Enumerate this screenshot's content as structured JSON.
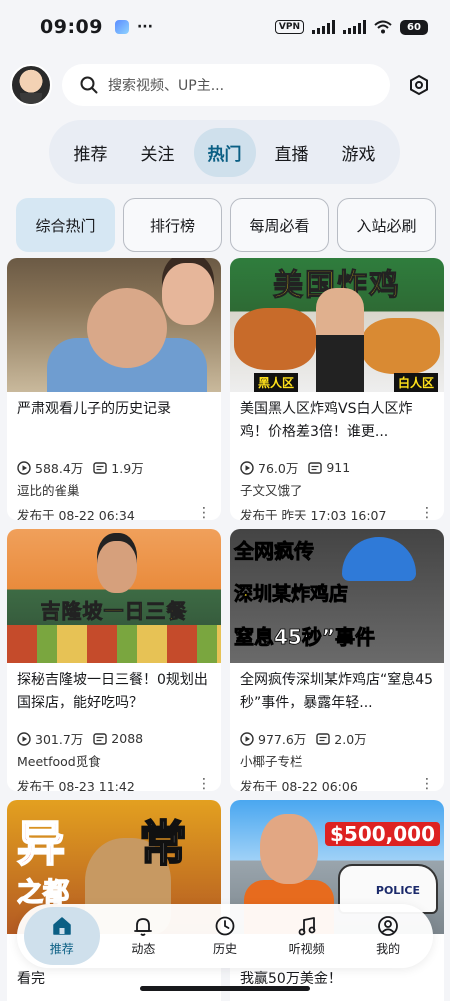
{
  "status_bar": {
    "time": "09:09",
    "dots": "···",
    "vpn": "VPN",
    "battery": "60"
  },
  "search": {
    "placeholder": "搜索视频、UP主..."
  },
  "main_tabs": [
    {
      "label": "推荐",
      "active": false
    },
    {
      "label": "关注",
      "active": false
    },
    {
      "label": "热门",
      "active": true
    },
    {
      "label": "直播",
      "active": false
    },
    {
      "label": "游戏",
      "active": false
    }
  ],
  "sub_tabs": [
    {
      "label": "综合热门",
      "active": true
    },
    {
      "label": "排行榜",
      "active": false
    },
    {
      "label": "每周必看",
      "active": false
    },
    {
      "label": "入站必刷",
      "active": false
    }
  ],
  "videos": [
    {
      "title": "严肃观看儿子的历史记录",
      "views": "588.4万",
      "danmaku": "1.9万",
      "uploader": "逗比的雀巢",
      "published": "发布于 08-22 06:34"
    },
    {
      "title": "美国黑人区炸鸡VS白人区炸鸡！价格差3倍！谁更...",
      "views": "76.0万",
      "danmaku": "911",
      "uploader": "子文又饿了",
      "published": "发布于 昨天 17:03 16:07",
      "thumb_text": {
        "headline": "美国炸鸡",
        "left_label": "黑人区",
        "right_label": "白人区"
      }
    },
    {
      "title": "探秘吉隆坡一日三餐！0规划出国探店，能好吃吗？",
      "views": "301.7万",
      "danmaku": "2088",
      "uploader": "Meetfood觅食",
      "published": "发布于 08-23 11:42",
      "thumb_text": {
        "headline": "吉隆坡一日三餐"
      }
    },
    {
      "title": "全网疯传深圳某炸鸡店“窒息45秒”事件，暴露年轻...",
      "views": "977.6万",
      "danmaku": "2.0万",
      "uploader": "小椰子专栏",
      "published": "发布于 08-22 06:06",
      "thumb_text": {
        "line1": "全网疯传",
        "line2": "深圳某炸鸡店",
        "line3": "窒息45秒”事件"
      }
    },
    {
      "title_peek": "看完",
      "thumb_text": {
        "a": "异",
        "b": "常",
        "c": "之都"
      }
    },
    {
      "title_peek": "我赢50万美金！",
      "thumb_text": {
        "price": "$500,000",
        "police": "POLICE"
      }
    }
  ],
  "bottom_nav": [
    {
      "label": "推荐",
      "icon": "home-icon",
      "active": true
    },
    {
      "label": "动态",
      "icon": "bell-icon",
      "active": false
    },
    {
      "label": "历史",
      "icon": "clock-icon",
      "active": false
    },
    {
      "label": "听视频",
      "icon": "music-note-icon",
      "active": false
    },
    {
      "label": "我的",
      "icon": "user-icon",
      "active": false
    }
  ],
  "colors": {
    "accent": "#0b5f84",
    "accent_bg": "#cfe0ec",
    "background": "#f4f5f8"
  }
}
